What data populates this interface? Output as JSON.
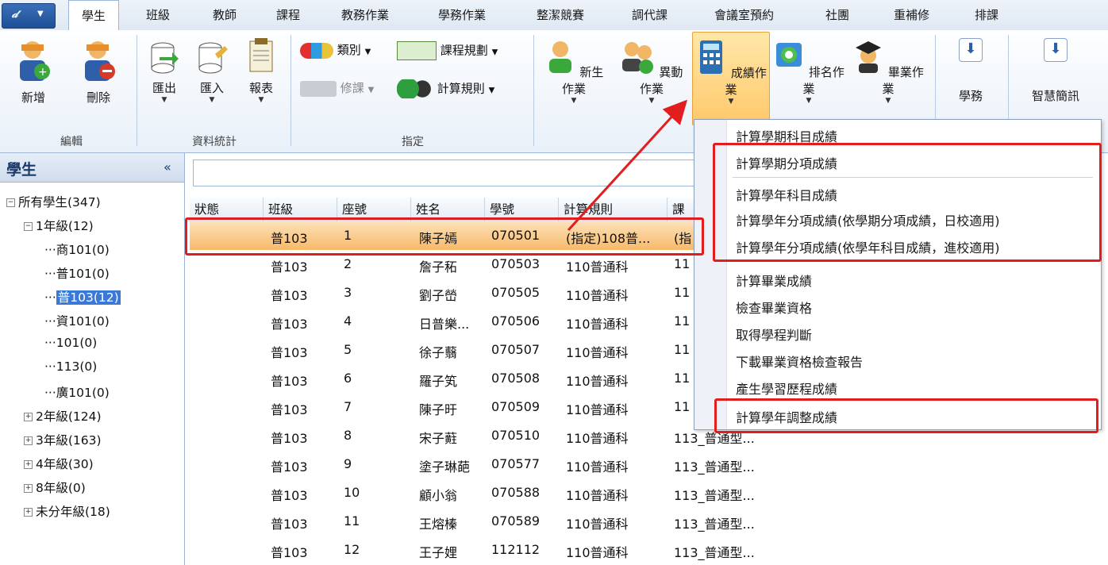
{
  "tabs": [
    "學生",
    "班級",
    "教師",
    "課程",
    "教務作業",
    "學務作業",
    "整潔競賽",
    "調代課",
    "會議室預約",
    "社團",
    "重補修",
    "排課"
  ],
  "ribbon": {
    "edit": {
      "add": "新增",
      "delete": "刪除",
      "group": "編輯"
    },
    "stats": {
      "export": "匯出",
      "import": "匯入",
      "report": "報表",
      "group": "資料統計"
    },
    "assign": {
      "category": "類別",
      "course_plan": "課程規劃",
      "elective": "修課",
      "calc_rule": "計算規則",
      "group": "指定"
    },
    "ops": {
      "new_student": "新生作業",
      "transfer": "異動作業",
      "score": "成績作業",
      "ranking": "排名作業",
      "graduation": "畢業作業",
      "academic": "學務",
      "smart_msg": "智慧簡訊"
    }
  },
  "left": {
    "title": "學生",
    "collapse": "«",
    "tree": {
      "root": "所有學生(347)",
      "g1": "1年級(12)",
      "classes": [
        "商101(0)",
        "普101(0)",
        "普103(12)",
        "資101(0)",
        "101(0)",
        "113(0)",
        "廣101(0)"
      ],
      "grades": [
        "2年級(124)",
        "3年級(163)",
        "4年級(30)",
        "8年級(0)",
        "未分年級(18)"
      ]
    }
  },
  "grid": {
    "headers": [
      "狀態",
      "班級",
      "座號",
      "姓名",
      "學號",
      "計算規則",
      "課"
    ],
    "rows": [
      [
        "",
        "普103",
        "1",
        "陳子嫣",
        "070501",
        "(指定)108普...",
        "(指"
      ],
      [
        "",
        "普103",
        "2",
        "詹子䄷",
        "070503",
        "110普通科",
        "11"
      ],
      [
        "",
        "普103",
        "3",
        "劉子嵤",
        "070505",
        "110普通科",
        "11"
      ],
      [
        "",
        "普103",
        "4",
        "日普樂...",
        "070506",
        "110普通科",
        "11"
      ],
      [
        "",
        "普103",
        "5",
        "徐子蘙",
        "070507",
        "110普通科",
        "11"
      ],
      [
        "",
        "普103",
        "6",
        "羅子笂",
        "070508",
        "110普通科",
        "11"
      ],
      [
        "",
        "普103",
        "7",
        "陳子旴",
        "070509",
        "110普通科",
        "11"
      ],
      [
        "",
        "普103",
        "8",
        "宋子蘣",
        "070510",
        "110普通科",
        "113_普通型..."
      ],
      [
        "",
        "普103",
        "9",
        "塗子琳葩",
        "070577",
        "110普通科",
        "113_普通型..."
      ],
      [
        "",
        "普103",
        "10",
        "顧小翁",
        "070588",
        "110普通科",
        "113_普通型..."
      ],
      [
        "",
        "普103",
        "11",
        "王熔榛",
        "070589",
        "110普通科",
        "113_普通型..."
      ],
      [
        "",
        "普103",
        "12",
        "王子娌",
        "112112",
        "110普通科",
        "113_普通型..."
      ]
    ]
  },
  "menu": {
    "items": [
      "計算學期科目成績",
      "計算學期分項成績",
      "計算學年科目成績",
      "計算學年分項成績(依學期分項成績，日校適用)",
      "計算學年分項成績(依學年科目成績，進校適用)",
      "計算畢業成績",
      "檢查畢業資格",
      "取得學程判斷",
      "下載畢業資格檢查報告",
      "產生學習歷程成績",
      "計算學年調整成績"
    ]
  },
  "colors": {
    "highlight": "#e21d1d",
    "selection": "#f7b96b",
    "accent": "#3b78d8"
  }
}
